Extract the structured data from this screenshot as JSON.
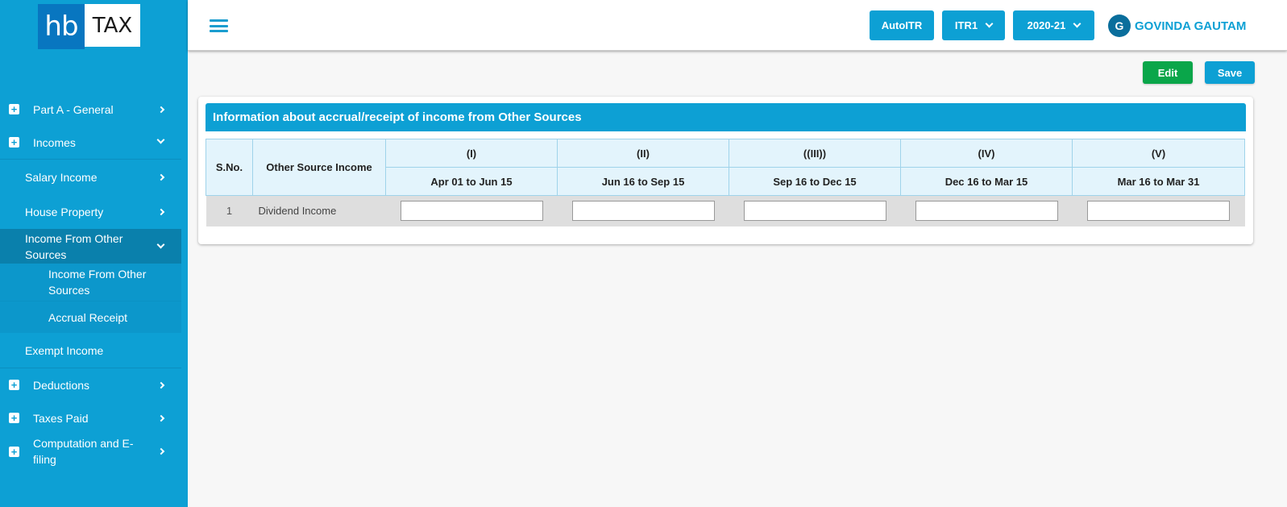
{
  "brand": {
    "logo_left": "hb",
    "logo_right": "TAX"
  },
  "sidebar": {
    "items": [
      {
        "label": "Part A - General",
        "icon": "plus-square-icon",
        "chevron": "right"
      },
      {
        "label": "Incomes",
        "icon": "plus-square-icon",
        "chevron": "down"
      },
      {
        "label": "Salary Income",
        "chevron": "right"
      },
      {
        "label": "House Property",
        "chevron": "right"
      },
      {
        "label": "Income From Other Sources",
        "chevron": "down",
        "active": true
      },
      {
        "label": "Income From Other Sources"
      },
      {
        "label": "Accrual Receipt"
      },
      {
        "label": "Exempt Income"
      },
      {
        "label": "Deductions",
        "icon": "plus-square-icon",
        "chevron": "right"
      },
      {
        "label": "Taxes Paid",
        "icon": "plus-square-icon",
        "chevron": "right"
      },
      {
        "label": "Computation and E-filing",
        "icon": "plus-square-icon",
        "chevron": "right"
      }
    ]
  },
  "header": {
    "autoitr_label": "AutoITR",
    "form_select": "ITR1",
    "year_select": "2020-21",
    "user_initial": "G",
    "user_name": "GOVINDA GAUTAM"
  },
  "actions": {
    "edit_label": "Edit",
    "save_label": "Save"
  },
  "colors": {
    "primary": "#0da0d4",
    "active_nav": "#0a80ac",
    "edit_green": "#0aa64a",
    "header_cell": "#e3f4fc"
  },
  "card": {
    "title": "Information about accrual/receipt of income from Other Sources",
    "table": {
      "col_sno": "S.No.",
      "col_name": "Other Source Income",
      "periods": [
        {
          "roman": "(I)",
          "range": "Apr 01 to Jun 15"
        },
        {
          "roman": "(II)",
          "range": "Jun 16 to Sep 15"
        },
        {
          "roman": "((III))",
          "range": "Sep 16 to Dec 15"
        },
        {
          "roman": "(IV)",
          "range": "Dec 16 to Mar 15"
        },
        {
          "roman": "(V)",
          "range": "Mar 16 to Mar 31"
        }
      ],
      "rows": [
        {
          "sno": "1",
          "name": "Dividend Income",
          "values": [
            "",
            "",
            "",
            "",
            ""
          ]
        }
      ]
    }
  }
}
